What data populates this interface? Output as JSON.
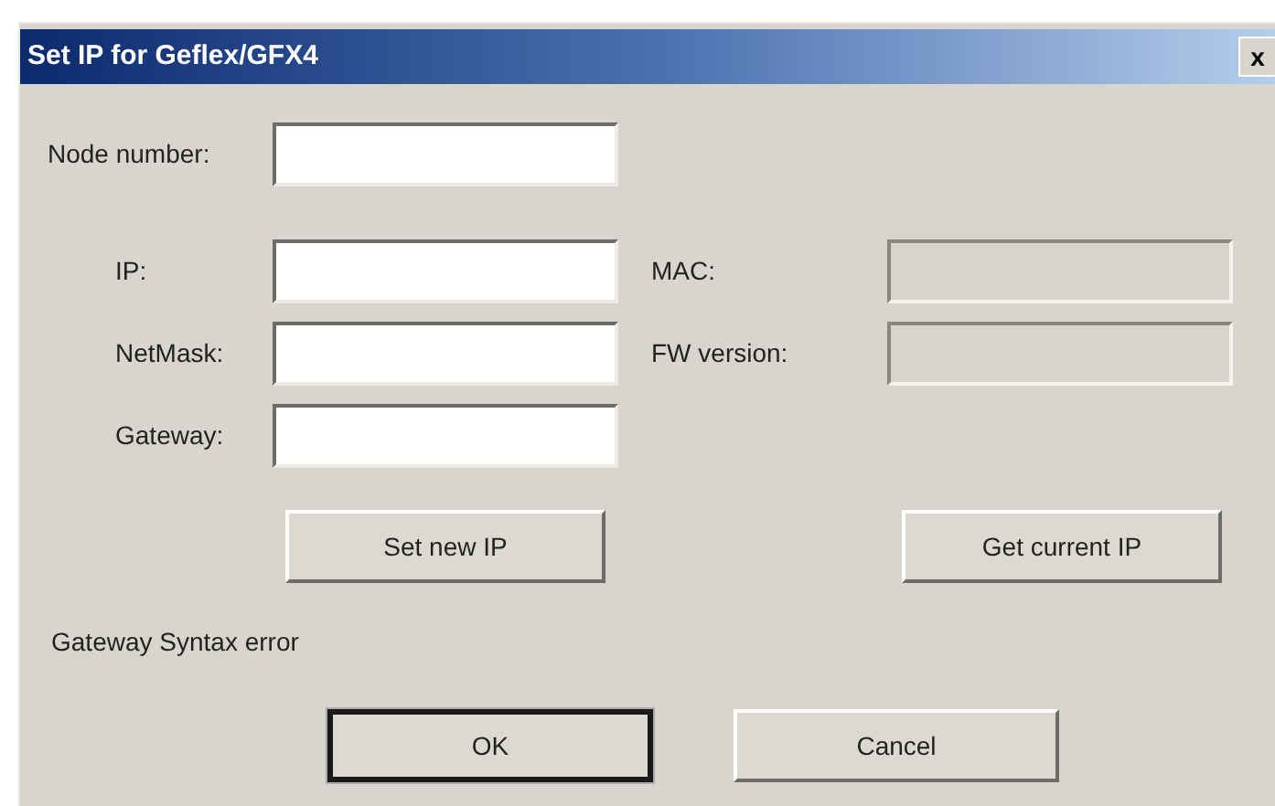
{
  "window": {
    "title": "Set IP for Geflex/GFX4",
    "close": "x"
  },
  "node_number": {
    "label": "Node number:",
    "disabled": false
  },
  "left_fields": [
    {
      "label": "IP:",
      "disabled": false
    },
    {
      "label": "NetMask:",
      "disabled": false
    },
    {
      "label": "Gateway:",
      "disabled": false
    }
  ],
  "right_fields": [
    {
      "label": "MAC:",
      "disabled": true
    },
    {
      "label": "FW version:",
      "disabled": true
    }
  ],
  "action_buttons": [
    {
      "label": "Set new IP"
    },
    {
      "label": "Get current IP"
    }
  ],
  "message": "Gateway Syntax error",
  "dialog_buttons": [
    {
      "label": "OK",
      "default": true
    },
    {
      "label": "Cancel",
      "default": false
    }
  ]
}
